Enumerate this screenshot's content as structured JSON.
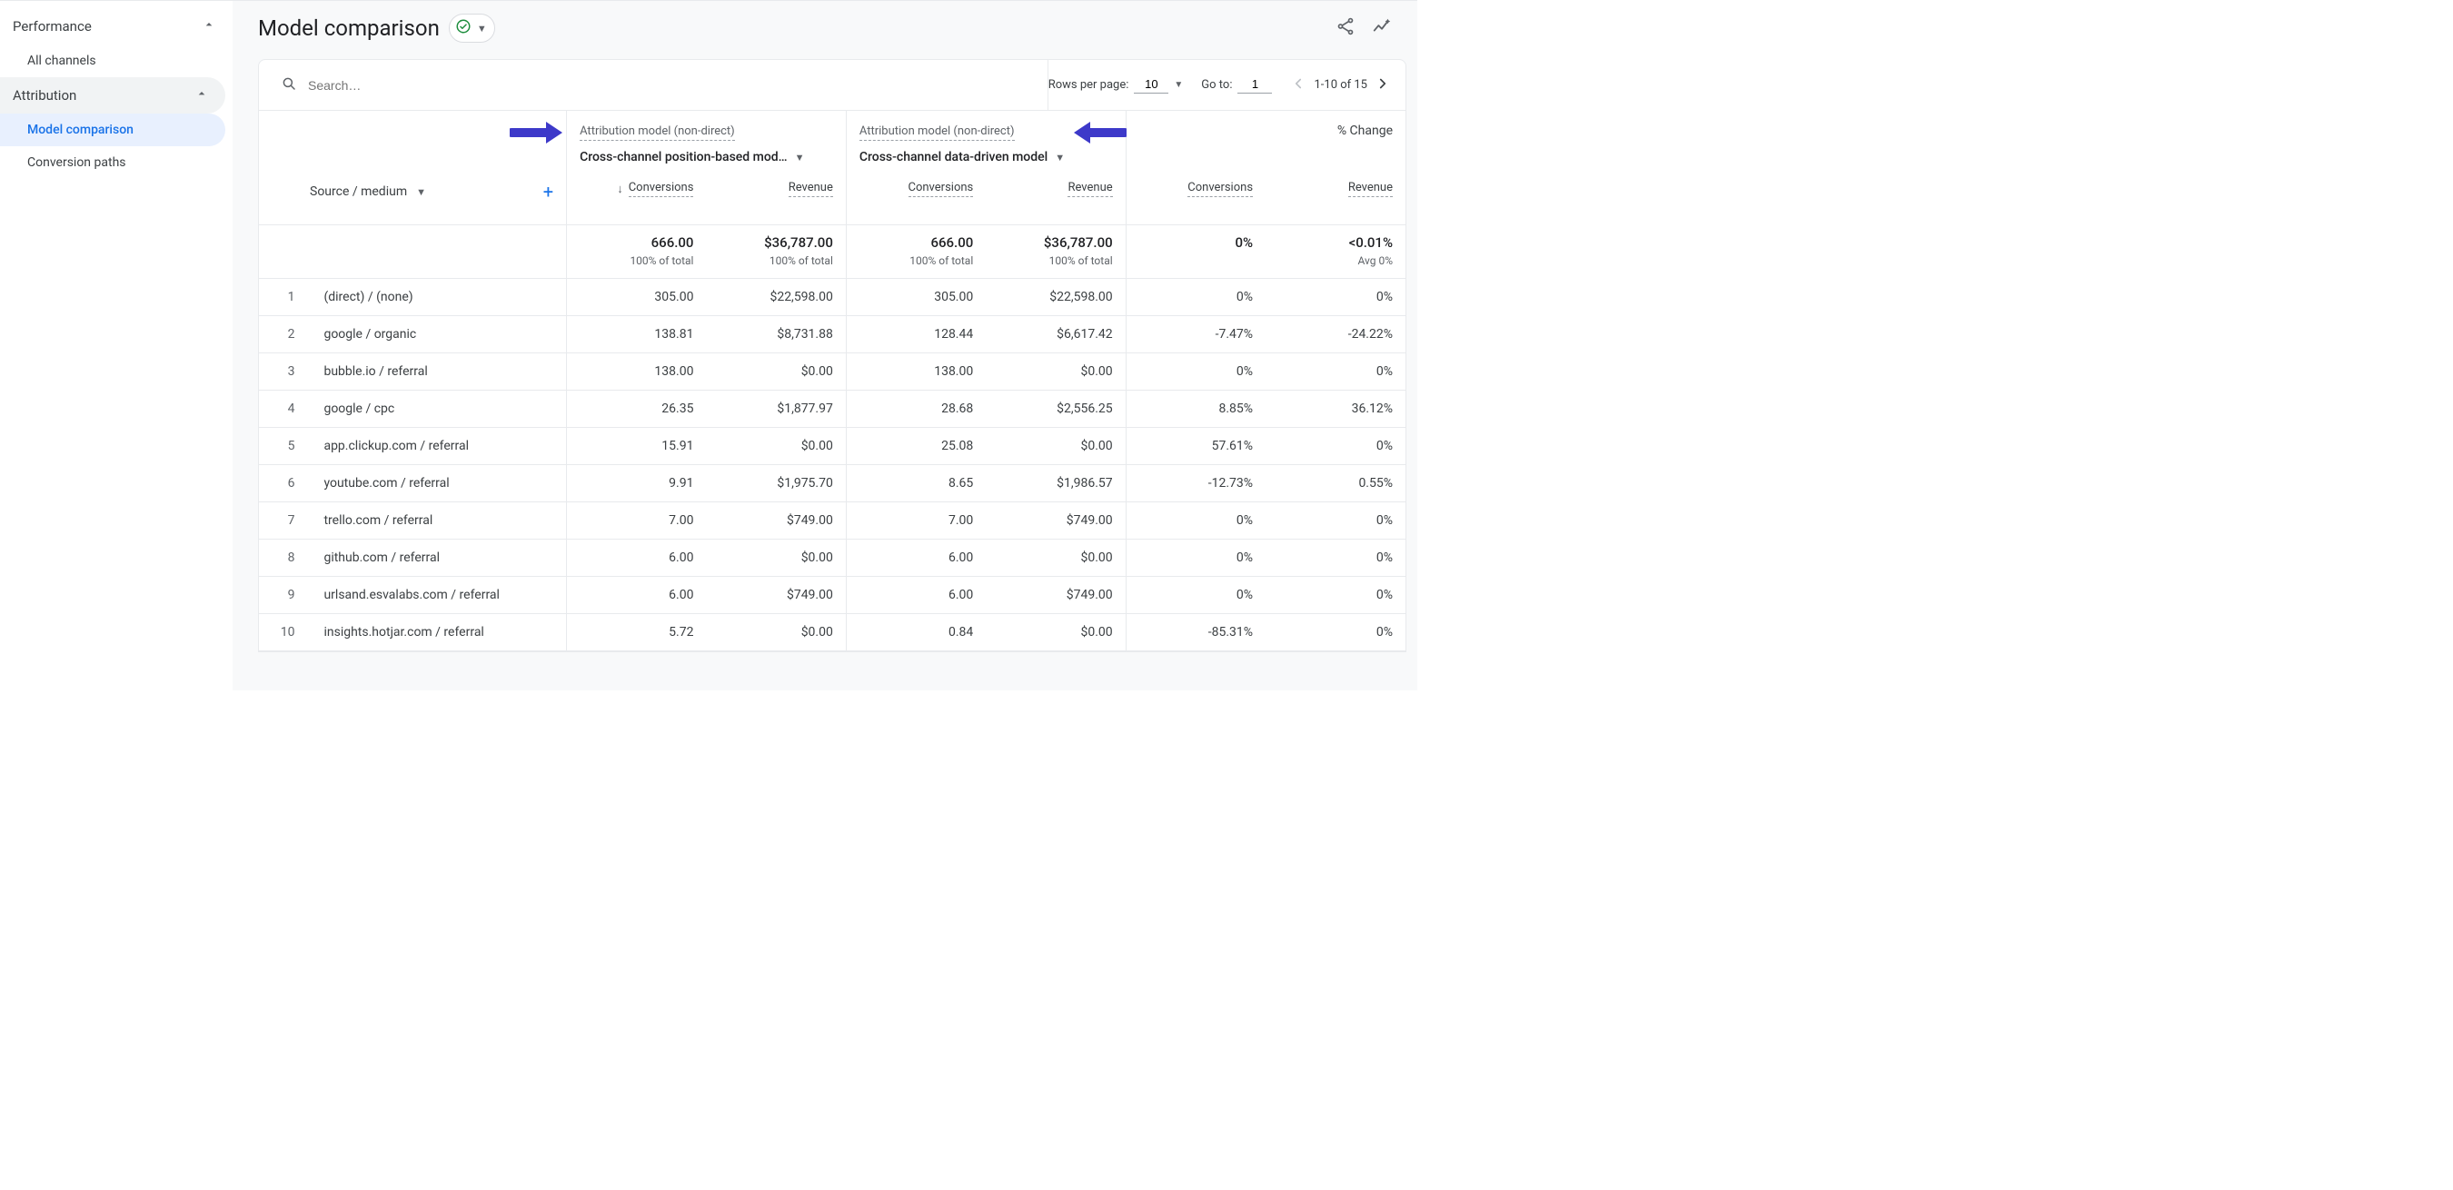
{
  "sidebar": {
    "groups": [
      {
        "label": "Performance",
        "expanded": true,
        "items": [
          {
            "label": "All channels",
            "active": false
          }
        ]
      },
      {
        "label": "Attribution",
        "expanded": true,
        "active_group": true,
        "items": [
          {
            "label": "Model comparison",
            "active": true
          },
          {
            "label": "Conversion paths",
            "active": false
          }
        ]
      }
    ]
  },
  "header": {
    "title": "Model comparison"
  },
  "toolbar": {
    "search_placeholder": "Search…",
    "rows_label": "Rows per page:",
    "rows_value": "10",
    "goto_label": "Go to:",
    "goto_value": "1",
    "range_text": "1-10 of 15"
  },
  "columns": {
    "model_label": "Attribution model (non-direct)",
    "model_a": "Cross-channel position-based mod…",
    "model_b": "Cross-channel data-driven model",
    "change_label": "% Change",
    "dimension": "Source / medium",
    "conversions": "Conversions",
    "revenue": "Revenue"
  },
  "totals": {
    "a_conv": "666.00",
    "a_conv_sub": "100% of total",
    "a_rev": "$36,787.00",
    "a_rev_sub": "100% of total",
    "b_conv": "666.00",
    "b_conv_sub": "100% of total",
    "b_rev": "$36,787.00",
    "b_rev_sub": "100% of total",
    "chg_conv": "0%",
    "chg_rev": "<0.01%",
    "chg_rev_sub": "Avg 0%"
  },
  "rows": [
    {
      "idx": "1",
      "dim": "(direct) / (none)",
      "a_conv": "305.00",
      "a_rev": "$22,598.00",
      "b_conv": "305.00",
      "b_rev": "$22,598.00",
      "c_conv": "0%",
      "c_rev": "0%"
    },
    {
      "idx": "2",
      "dim": "google / organic",
      "a_conv": "138.81",
      "a_rev": "$8,731.88",
      "b_conv": "128.44",
      "b_rev": "$6,617.42",
      "c_conv": "-7.47%",
      "c_rev": "-24.22%"
    },
    {
      "idx": "3",
      "dim": "bubble.io / referral",
      "a_conv": "138.00",
      "a_rev": "$0.00",
      "b_conv": "138.00",
      "b_rev": "$0.00",
      "c_conv": "0%",
      "c_rev": "0%"
    },
    {
      "idx": "4",
      "dim": "google / cpc",
      "a_conv": "26.35",
      "a_rev": "$1,877.97",
      "b_conv": "28.68",
      "b_rev": "$2,556.25",
      "c_conv": "8.85%",
      "c_rev": "36.12%"
    },
    {
      "idx": "5",
      "dim": "app.clickup.com / referral",
      "a_conv": "15.91",
      "a_rev": "$0.00",
      "b_conv": "25.08",
      "b_rev": "$0.00",
      "c_conv": "57.61%",
      "c_rev": "0%"
    },
    {
      "idx": "6",
      "dim": "youtube.com / referral",
      "a_conv": "9.91",
      "a_rev": "$1,975.70",
      "b_conv": "8.65",
      "b_rev": "$1,986.57",
      "c_conv": "-12.73%",
      "c_rev": "0.55%"
    },
    {
      "idx": "7",
      "dim": "trello.com / referral",
      "a_conv": "7.00",
      "a_rev": "$749.00",
      "b_conv": "7.00",
      "b_rev": "$749.00",
      "c_conv": "0%",
      "c_rev": "0%"
    },
    {
      "idx": "8",
      "dim": "github.com / referral",
      "a_conv": "6.00",
      "a_rev": "$0.00",
      "b_conv": "6.00",
      "b_rev": "$0.00",
      "c_conv": "0%",
      "c_rev": "0%"
    },
    {
      "idx": "9",
      "dim": "urlsand.esvalabs.com / referral",
      "a_conv": "6.00",
      "a_rev": "$749.00",
      "b_conv": "6.00",
      "b_rev": "$749.00",
      "c_conv": "0%",
      "c_rev": "0%"
    },
    {
      "idx": "10",
      "dim": "insights.hotjar.com / referral",
      "a_conv": "5.72",
      "a_rev": "$0.00",
      "b_conv": "0.84",
      "b_rev": "$0.00",
      "c_conv": "-85.31%",
      "c_rev": "0%"
    }
  ]
}
